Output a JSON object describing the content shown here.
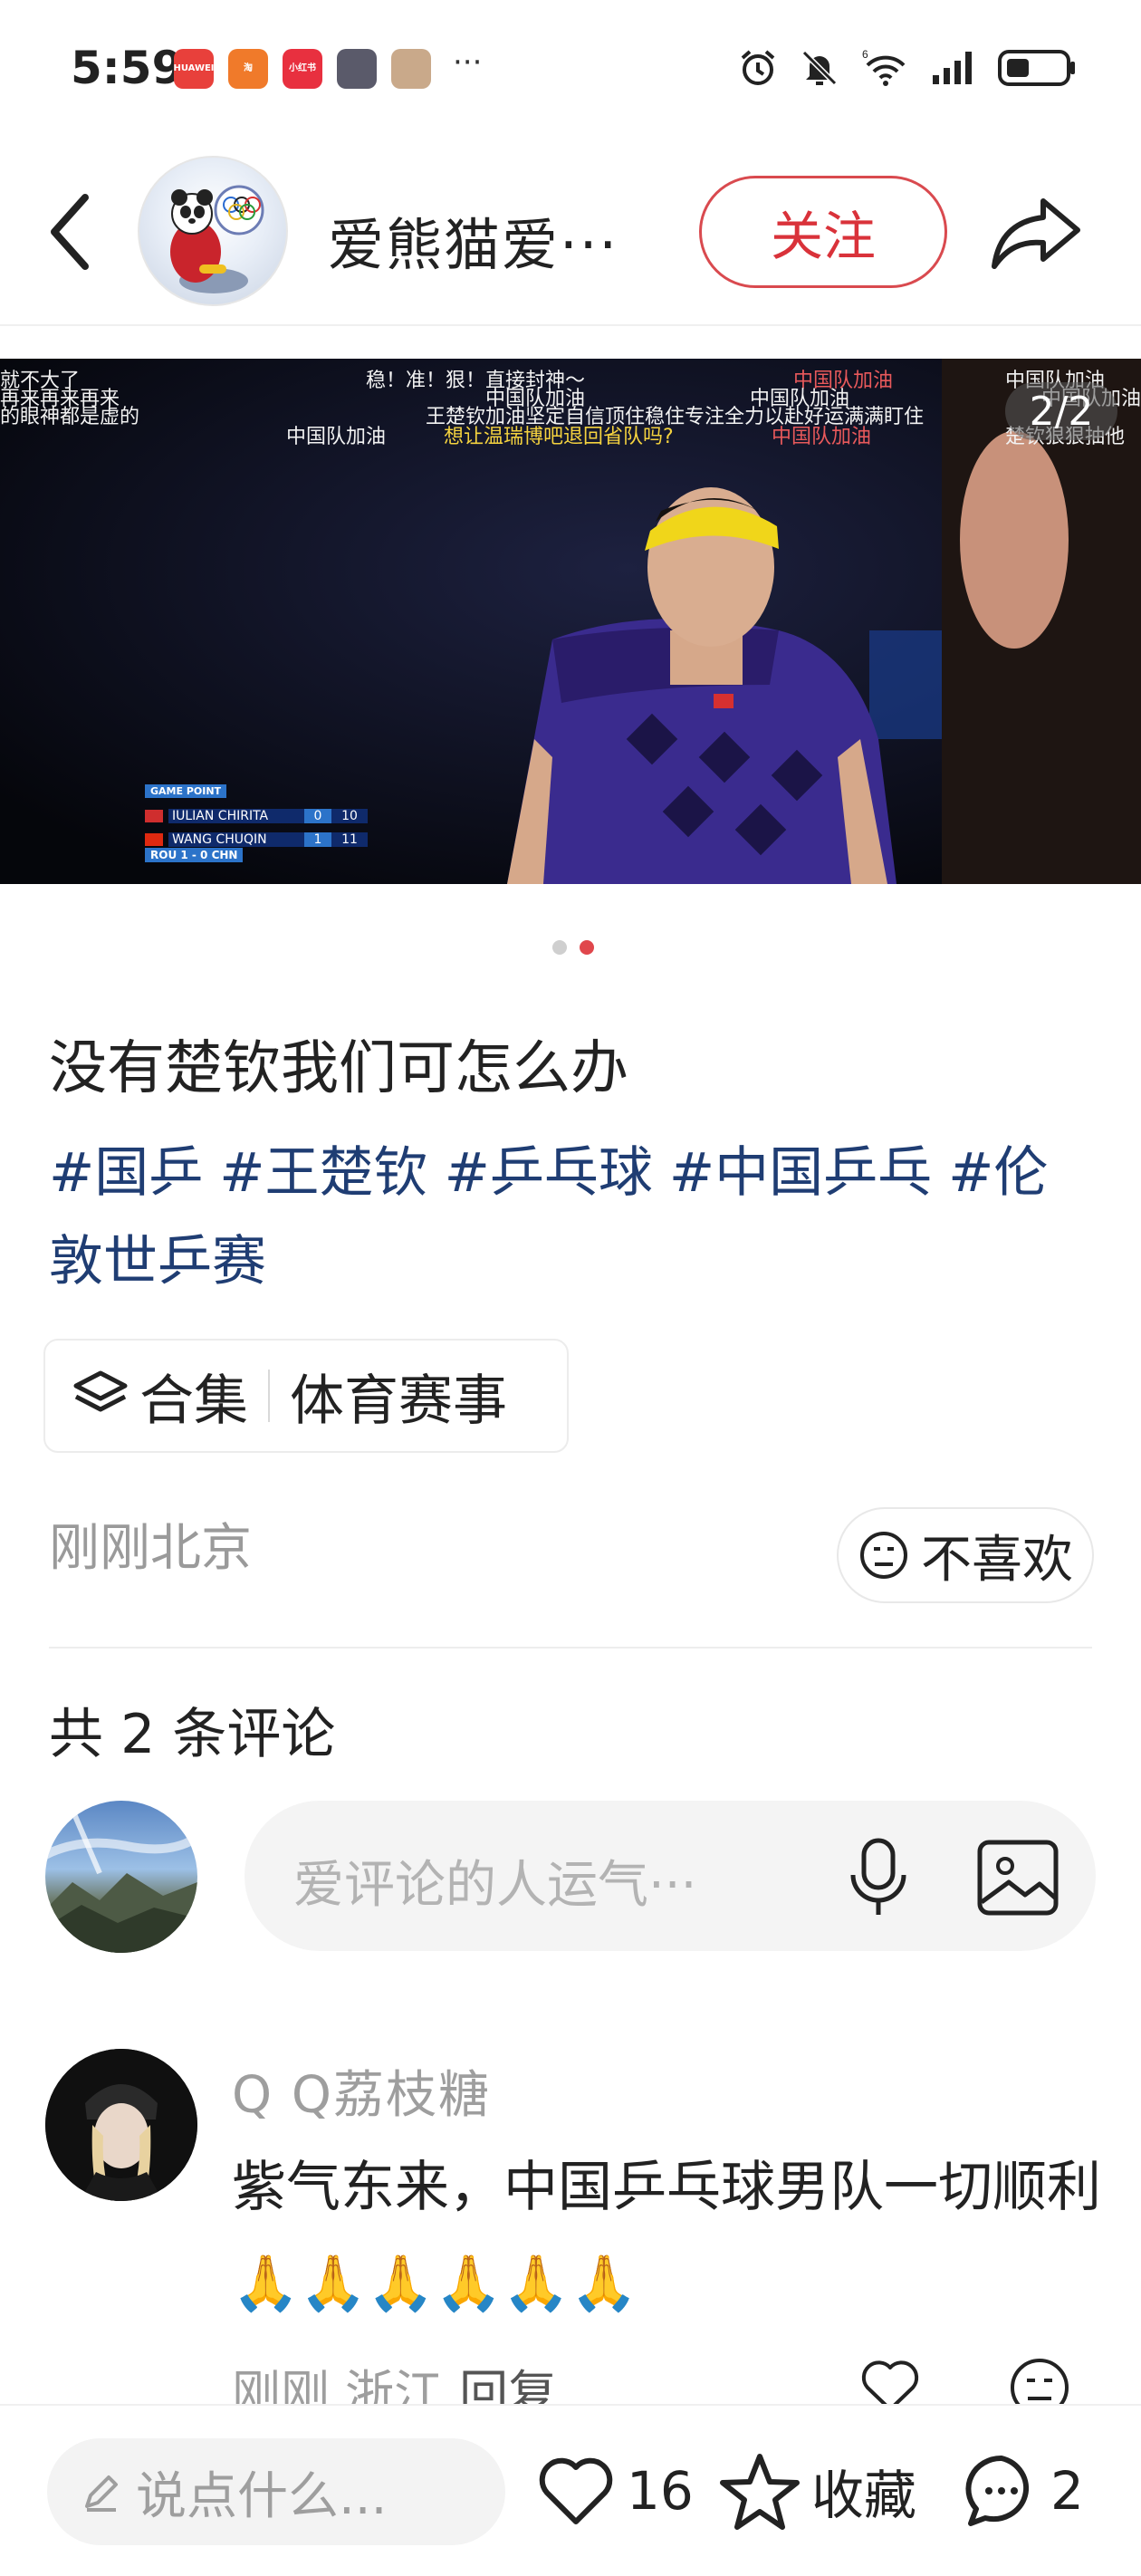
{
  "status_bar": {
    "time": "5:59",
    "apps": [
      {
        "name": "huawei-app-icon",
        "label": "HUAWEI",
        "color": "#e8403b"
      },
      {
        "name": "taobao-app-icon",
        "label": "淘",
        "color": "#f07a2a"
      },
      {
        "name": "xiaohongshu-app-icon",
        "label": "小红书",
        "color": "#e8303f"
      },
      {
        "name": "photo-app-icon",
        "label": "",
        "color": "#5a5a6a"
      },
      {
        "name": "profile-app-icon",
        "label": "",
        "color": "#c9a98a"
      }
    ],
    "more": "···",
    "network": "6"
  },
  "header": {
    "author_name": "爱熊猫爱···",
    "follow_label": "关注"
  },
  "media": {
    "page_indicator": "2/2",
    "danmaku": [
      {
        "text": "就不大了",
        "cls": ""
      },
      {
        "text": "再来再来再来",
        "cls": ""
      },
      {
        "text": "的眼神都是虚的",
        "cls": ""
      },
      {
        "text": "稳！准！狠！直接封神～",
        "cls": ""
      },
      {
        "text": "中国队加油",
        "cls": ""
      },
      {
        "text": "中国队加油",
        "cls": "r"
      },
      {
        "text": "中国队加油",
        "cls": ""
      },
      {
        "text": "中国队加油",
        "cls": ""
      },
      {
        "text": "王楚钦加油坚定自信顶住稳住专注全力以赴好运满满盯住",
        "cls": ""
      },
      {
        "text": "中国队加油",
        "cls": ""
      },
      {
        "text": "想让温瑞博吧退回省队吗?",
        "cls": "y"
      },
      {
        "text": "中国队加油",
        "cls": "r"
      },
      {
        "text": "楚钦狠狠抽他",
        "cls": ""
      },
      {
        "text": "中国队加油",
        "cls": ""
      }
    ],
    "scoreboard": {
      "header": "GAME POINT",
      "rows": [
        {
          "player": "IULIAN CHIRITA",
          "games": "0",
          "points": "10"
        },
        {
          "player": "WANG CHUQIN",
          "games": "1",
          "points": "11"
        }
      ],
      "footer": "ROU 1 - 0 CHN"
    }
  },
  "post": {
    "title": "没有楚钦我们可怎么办",
    "tags": [
      "#国乒",
      "#王楚钦",
      "#乒乓球",
      "#中国乒乓",
      "#伦敦世乒赛"
    ],
    "collection_label": "合集",
    "collection_value": "体育赛事",
    "time_location": "刚刚北京",
    "dislike_label": "不喜欢"
  },
  "comments": {
    "count_label": "共 2 条评论",
    "input_placeholder": "爱评论的人运气···",
    "items": [
      {
        "name": "Q Q荔枝糖",
        "text": "紫气东来，中国乒乓球男队一切顺利🙏🙏🙏🙏🙏🙏",
        "meta": "刚刚 浙江",
        "reply_label": "回复"
      }
    ]
  },
  "bottom_bar": {
    "input_placeholder": "说点什么...",
    "likes": "16",
    "collect_label": "收藏",
    "comment_count": "2"
  }
}
